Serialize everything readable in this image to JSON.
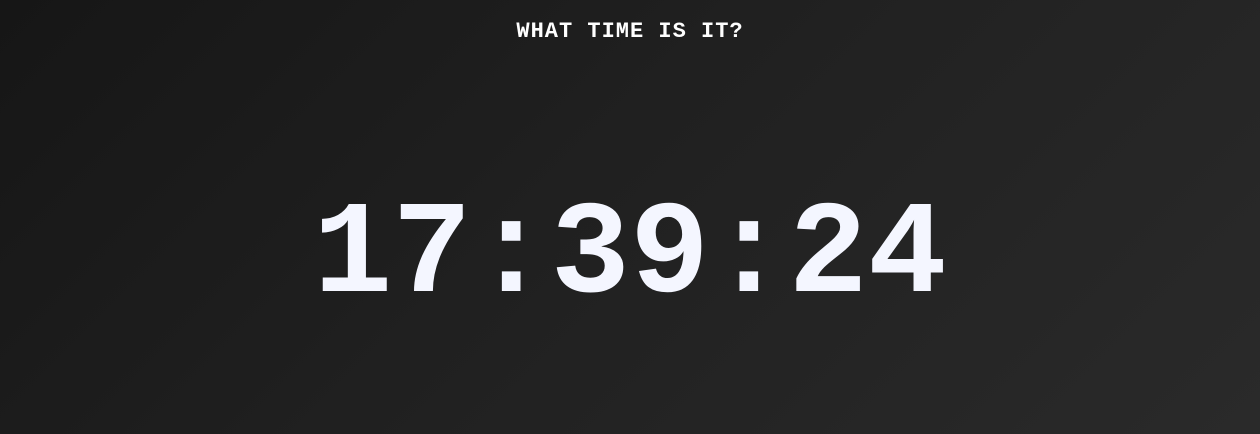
{
  "header": {
    "title": "WHAT TIME IS IT?"
  },
  "clock": {
    "time": "17:39:24"
  },
  "colors": {
    "background": "#1e1e1e",
    "text": "#f4f6ff"
  }
}
